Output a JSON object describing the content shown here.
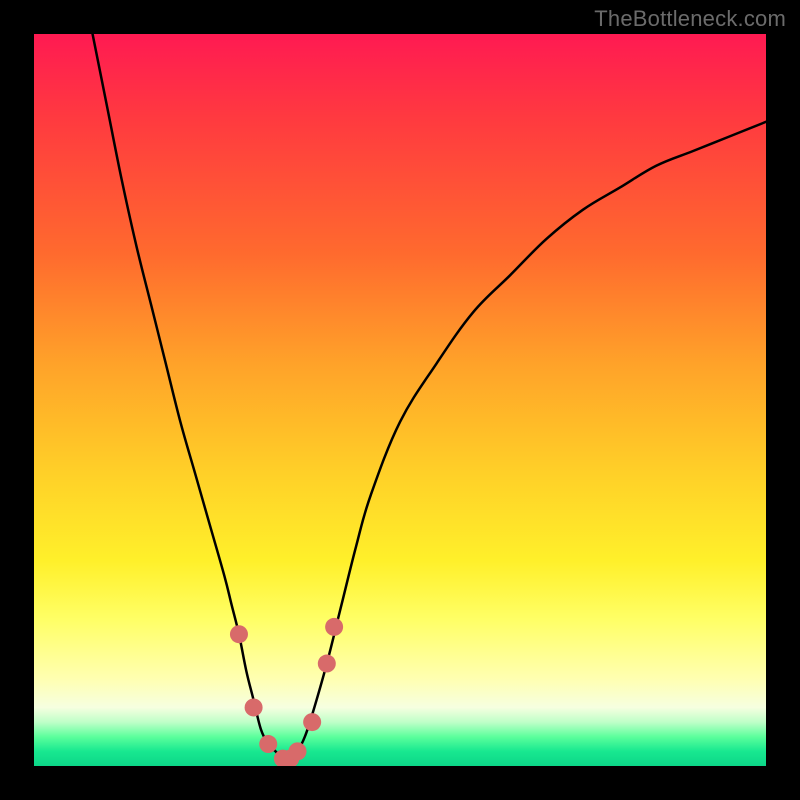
{
  "watermark": {
    "text": "TheBottleneck.com"
  },
  "chart_data": {
    "type": "line",
    "title": "",
    "xlabel": "",
    "ylabel": "",
    "xlim": [
      0,
      100
    ],
    "ylim": [
      0,
      100
    ],
    "grid": false,
    "legend": false,
    "series": [
      {
        "name": "curve",
        "color": "#000000",
        "x": [
          8,
          10,
          12,
          14,
          16,
          18,
          20,
          22,
          24,
          26,
          27,
          28,
          29,
          30,
          31,
          32,
          33,
          34,
          35,
          36,
          37,
          38,
          40,
          42,
          44,
          46,
          50,
          55,
          60,
          65,
          70,
          75,
          80,
          85,
          90,
          95,
          100
        ],
        "values": [
          100,
          90,
          80,
          71,
          63,
          55,
          47,
          40,
          33,
          26,
          22,
          18,
          13,
          9,
          5,
          3,
          2,
          1,
          1,
          2,
          4,
          7,
          14,
          22,
          30,
          37,
          47,
          55,
          62,
          67,
          72,
          76,
          79,
          82,
          84,
          86,
          88
        ]
      },
      {
        "name": "markers",
        "color": "#d86a6a",
        "type": "scatter",
        "points": [
          {
            "x": 28,
            "y": 18
          },
          {
            "x": 30,
            "y": 8
          },
          {
            "x": 32,
            "y": 3
          },
          {
            "x": 34,
            "y": 1
          },
          {
            "x": 35,
            "y": 1
          },
          {
            "x": 36,
            "y": 2
          },
          {
            "x": 38,
            "y": 6
          },
          {
            "x": 40,
            "y": 14
          },
          {
            "x": 41,
            "y": 19
          }
        ]
      }
    ]
  }
}
